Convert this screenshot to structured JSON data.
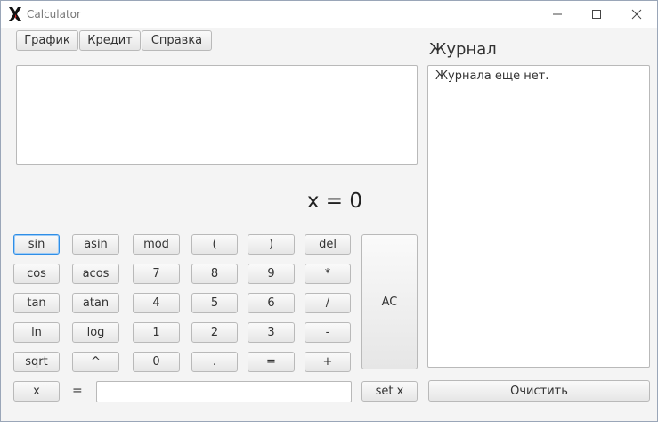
{
  "window": {
    "title": "Calculator"
  },
  "menu": {
    "graph": "График",
    "credit": "Кредит",
    "help": "Справка"
  },
  "display": {
    "expression": "",
    "result": "x = 0"
  },
  "keys": {
    "sin": "sin",
    "asin": "asin",
    "mod": "mod",
    "lparen": "(",
    "rparen": ")",
    "del": "del",
    "cos": "cos",
    "acos": "acos",
    "d7": "7",
    "d8": "8",
    "d9": "9",
    "mul": "*",
    "tan": "tan",
    "atan": "atan",
    "d4": "4",
    "d5": "5",
    "d6": "6",
    "div": "/",
    "ln": "ln",
    "log": "log",
    "d1": "1",
    "d2": "2",
    "d3": "3",
    "sub": "-",
    "sqrt": "sqrt",
    "pow": "^",
    "d0": "0",
    "dot": ".",
    "eq": "=",
    "add": "+",
    "ac": "AC"
  },
  "variable": {
    "x_button": "x",
    "equals": "=",
    "value": "",
    "set_button": "set x"
  },
  "history": {
    "heading": "Журнал",
    "empty_text": "Журнала еще нет.",
    "clear_button": "Очистить"
  }
}
